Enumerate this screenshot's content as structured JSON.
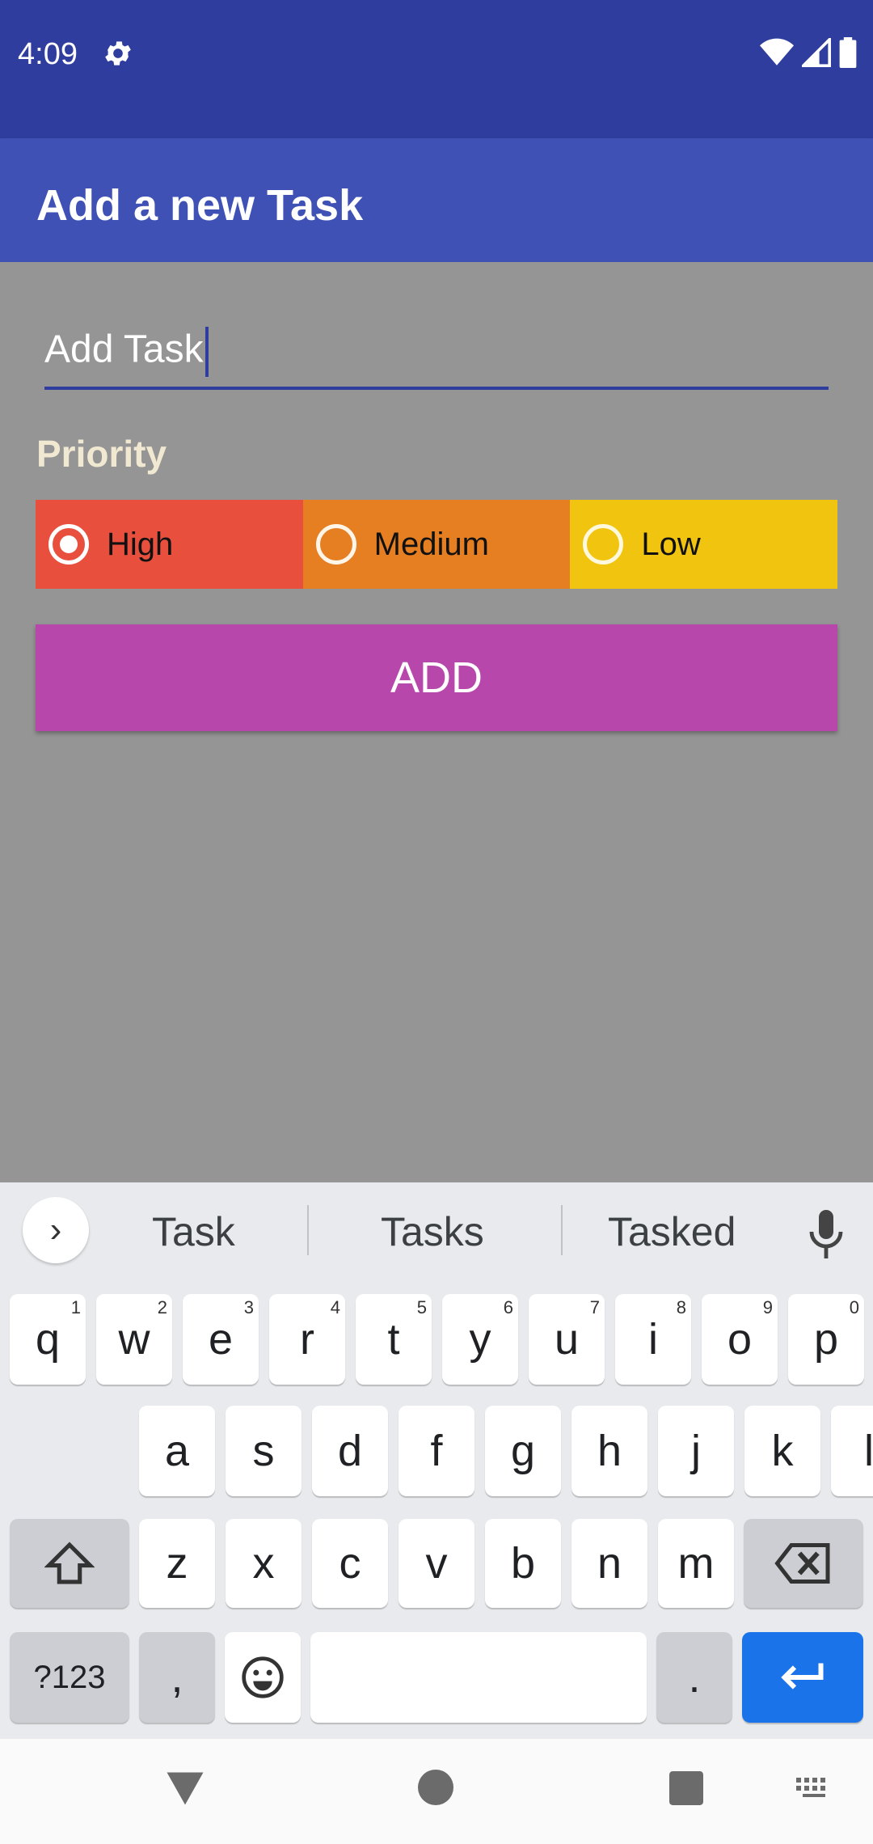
{
  "status_bar": {
    "time": "4:09",
    "icons": [
      "gear-icon",
      "wifi-icon",
      "cell-signal-icon",
      "battery-icon"
    ]
  },
  "app_bar": {
    "title": "Add a new Task"
  },
  "form": {
    "task_input": {
      "value": "Add Task"
    },
    "priority_label": "Priority",
    "priorities": [
      {
        "label": "High",
        "color": "#e8503d",
        "selected": true
      },
      {
        "label": "Medium",
        "color": "#e67e22",
        "selected": false
      },
      {
        "label": "Low",
        "color": "#f1c40f",
        "selected": false
      }
    ],
    "add_button": "ADD"
  },
  "keyboard": {
    "suggestions": [
      "Task",
      "Tasks",
      "Tasked"
    ],
    "row1": [
      {
        "key": "q",
        "hint": "1"
      },
      {
        "key": "w",
        "hint": "2"
      },
      {
        "key": "e",
        "hint": "3"
      },
      {
        "key": "r",
        "hint": "4"
      },
      {
        "key": "t",
        "hint": "5"
      },
      {
        "key": "y",
        "hint": "6"
      },
      {
        "key": "u",
        "hint": "7"
      },
      {
        "key": "i",
        "hint": "8"
      },
      {
        "key": "o",
        "hint": "9"
      },
      {
        "key": "p",
        "hint": "0"
      }
    ],
    "row2": [
      "a",
      "s",
      "d",
      "f",
      "g",
      "h",
      "j",
      "k",
      "l"
    ],
    "row3": [
      "z",
      "x",
      "c",
      "v",
      "b",
      "n",
      "m"
    ],
    "symbols_key": "?123",
    "comma_key": ",",
    "period_key": "."
  },
  "colors": {
    "status_bar": "#2f3e9e",
    "app_bar": "#3f51b5",
    "add_button": "#b847ab",
    "enter_key": "#1a73e8"
  }
}
